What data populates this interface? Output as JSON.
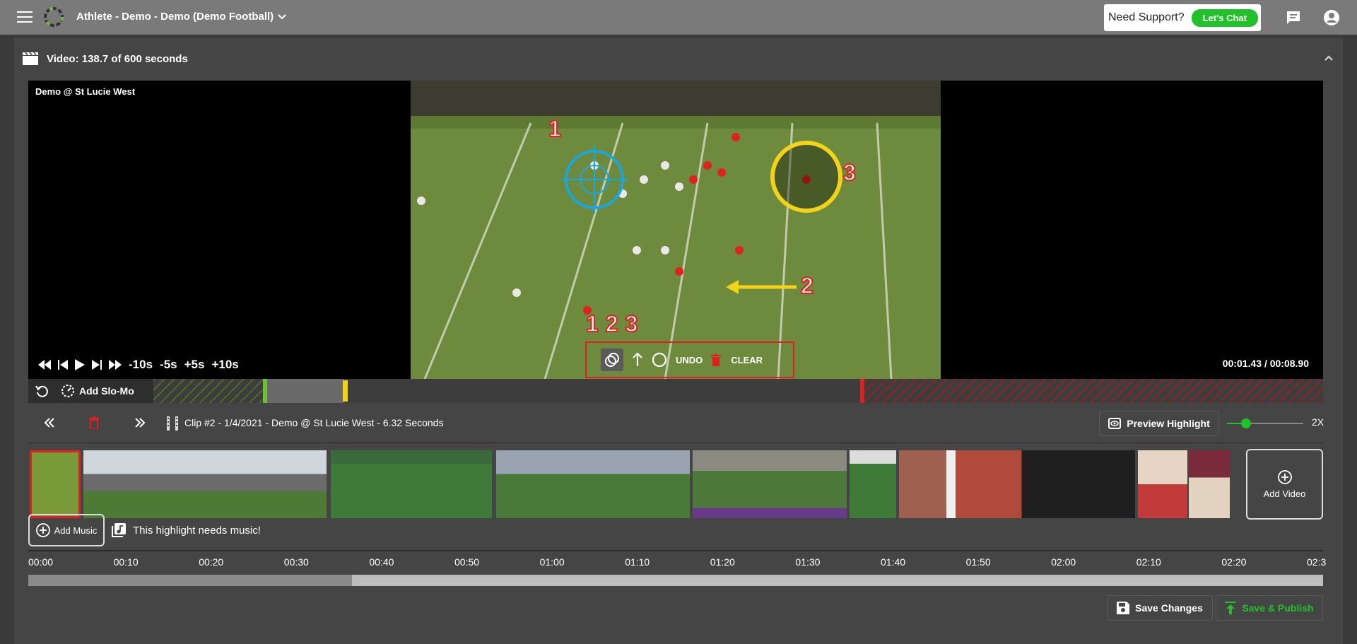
{
  "topbar": {
    "team_title": "Athlete - Demo - Demo (Demo Football)",
    "support_text": "Need Support?",
    "chat_label": "Let's Chat"
  },
  "video_panel": {
    "header": "Video: 138.7 of 600 seconds",
    "video_title": "Demo @ St Lucie West",
    "time_display": "00:01.43 / 00:08.90",
    "skip_buttons": [
      "-10s",
      "-5s",
      "+5s",
      "+10s"
    ],
    "draw_tools": {
      "undo": "UNDO",
      "clear": "CLEAR"
    },
    "overlay_labels": [
      "1",
      "2",
      "3"
    ],
    "tool_labels": [
      "1",
      "2",
      "3"
    ]
  },
  "trim": {
    "slomo_label": "Add Slo-Mo"
  },
  "clip": {
    "info": "Clip #2 - 1/4/2021 - Demo @ St Lucie West - 6.32 Seconds",
    "preview_label": "Preview Highlight",
    "speed": "2X",
    "speed_level": 0.2
  },
  "filmstrip": {
    "add_video": "Add Video"
  },
  "music": {
    "add_label": "Add Music",
    "notice": "This highlight needs music!"
  },
  "timeline": {
    "ticks": [
      "00:00",
      "00:10",
      "00:20",
      "00:30",
      "00:40",
      "00:50",
      "01:00",
      "01:10",
      "01:20",
      "01:30",
      "01:40",
      "01:50",
      "02:00",
      "02:10",
      "02:20",
      "02:3"
    ],
    "played_fraction": 0.25
  },
  "actions": {
    "save": "Save Changes",
    "publish": "Save & Publish"
  },
  "colors": {
    "accent": "#22c02a",
    "danger": "#e02020",
    "cyan": "#1aa7e0",
    "yellow": "#f2d21a"
  }
}
